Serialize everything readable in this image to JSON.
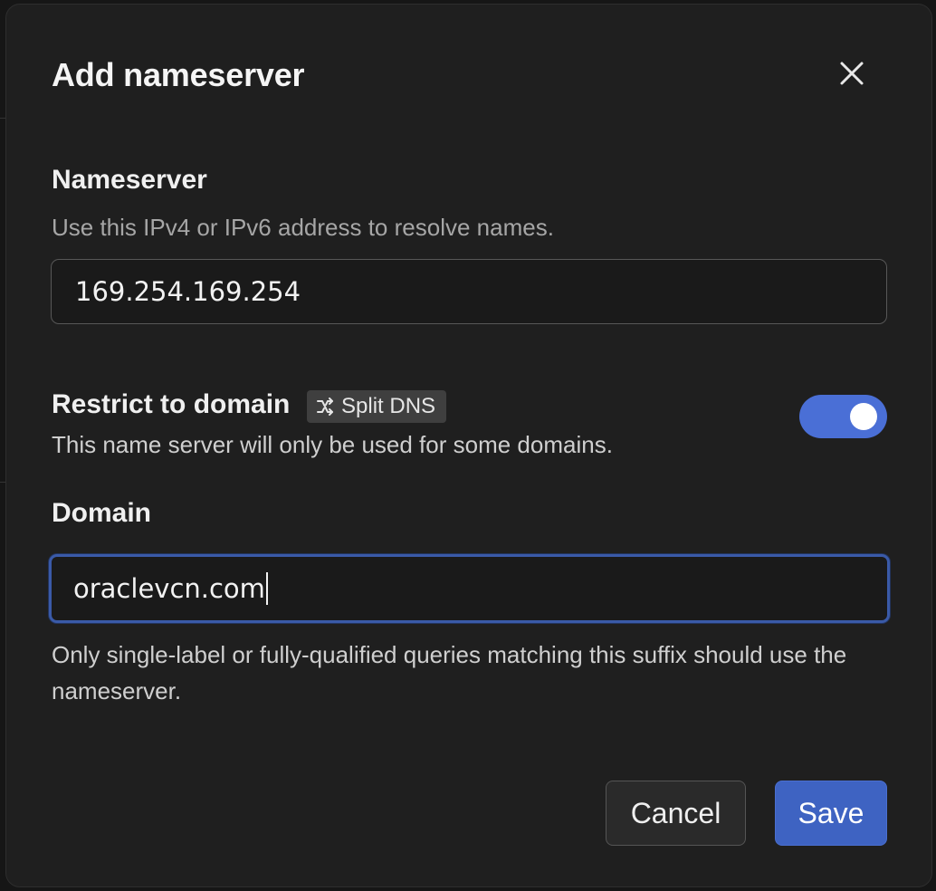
{
  "dialog": {
    "title": "Add nameserver",
    "close_icon": "close-icon"
  },
  "nameserver": {
    "label": "Nameserver",
    "help": "Use this IPv4 or IPv6 address to resolve names.",
    "value": "169.254.169.254"
  },
  "restrict": {
    "label": "Restrict to domain",
    "badge_icon": "shuffle-icon",
    "badge_label": "Split DNS",
    "help": "This name server will only be used for some domains.",
    "enabled": true
  },
  "domain": {
    "label": "Domain",
    "value": "oraclevcn.com",
    "help": "Only single-label or fully-qualified queries matching this suffix should use the nameserver."
  },
  "actions": {
    "cancel_label": "Cancel",
    "save_label": "Save"
  },
  "colors": {
    "accent": "#3e63c2",
    "toggle_on": "#4a6fd6",
    "dialog_bg": "#1f1f1f",
    "focus_ring": "#3a5aa8"
  }
}
